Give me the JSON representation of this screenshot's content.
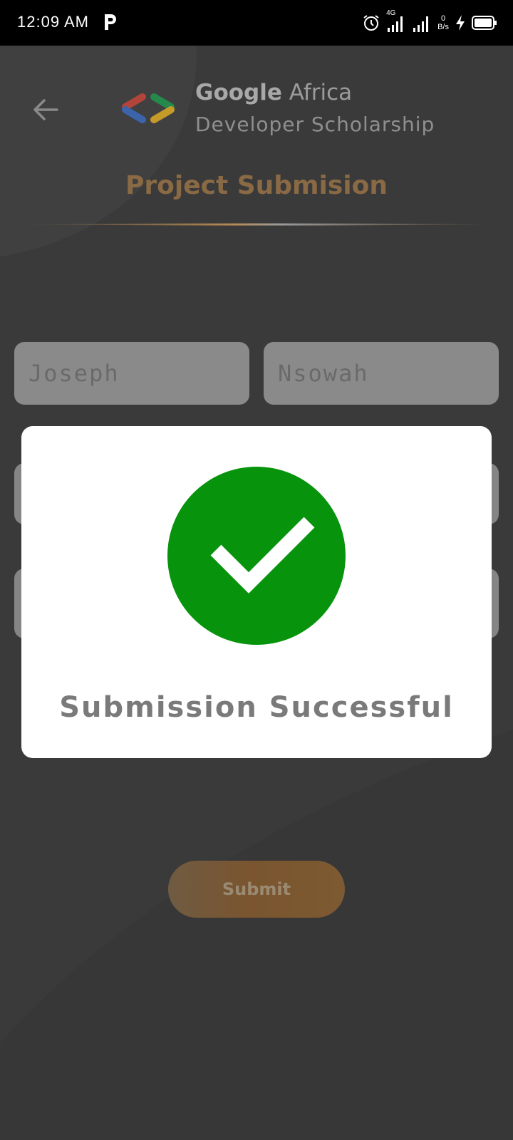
{
  "status_bar": {
    "time": "12:09 AM",
    "app_indicator": "P",
    "network_type": "4G",
    "net_speed_value": "0",
    "net_speed_unit": "B/s",
    "icons": [
      "alarm-icon",
      "signal-icon",
      "signal-icon",
      "charging-icon",
      "battery-icon"
    ]
  },
  "header": {
    "brand_google": "Google",
    "brand_africa": "Africa",
    "brand_line2": "Developer Scholarship",
    "page_title": "Project Submision"
  },
  "form": {
    "first_name": "Joseph",
    "last_name": "Nsowah",
    "submit_label": "Submit"
  },
  "dialog": {
    "message": "Submission Successful"
  },
  "colors": {
    "background": "#3a3a3a",
    "accent_gold": "#8a6a44",
    "success_green": "#07940c"
  }
}
